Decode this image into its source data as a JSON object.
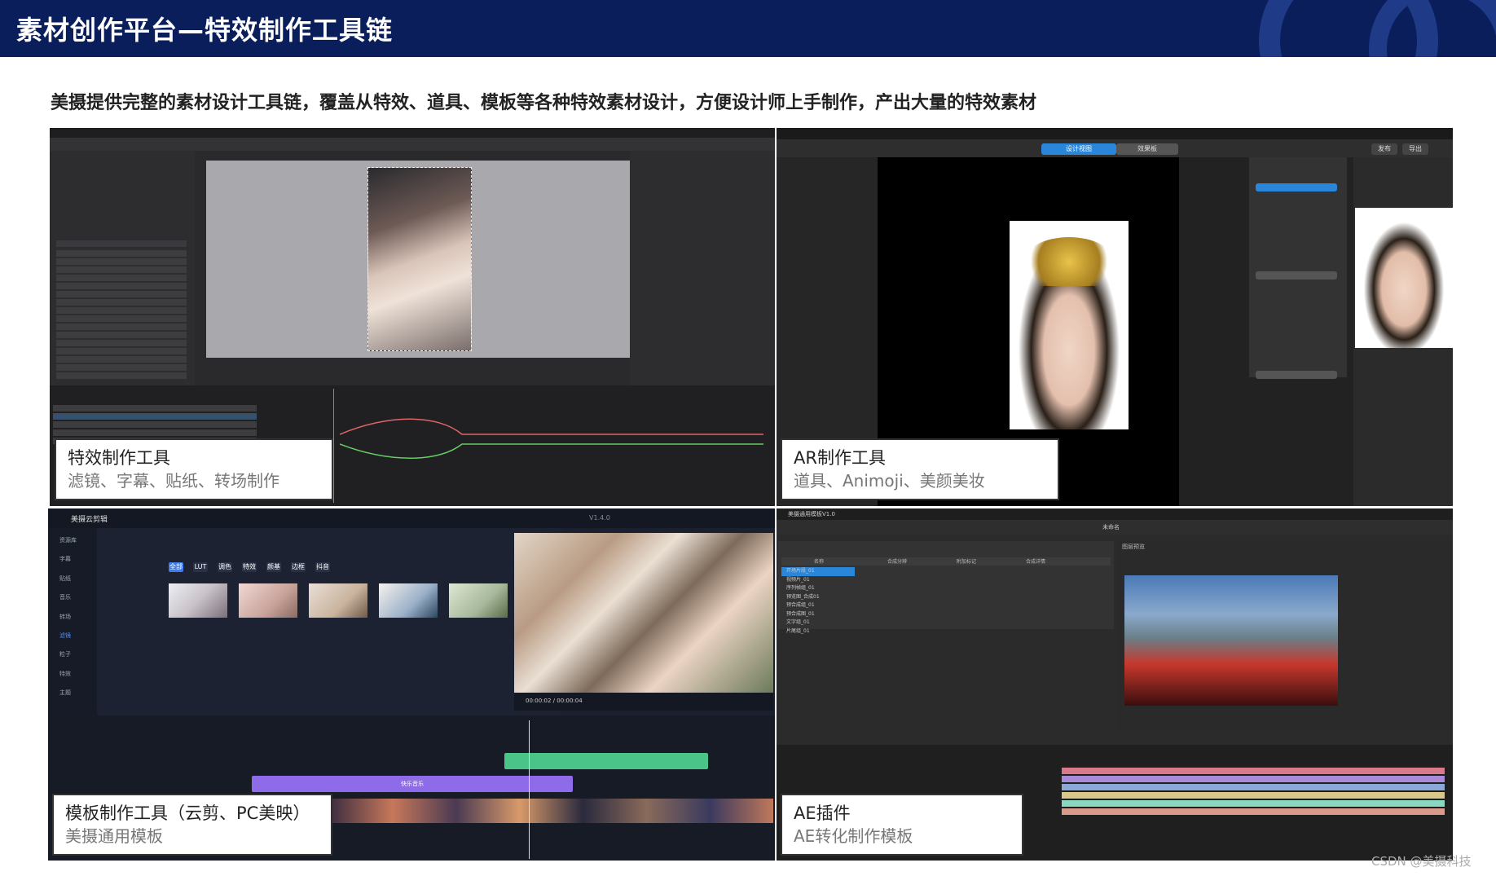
{
  "header": {
    "title": "素材创作平台—特效制作工具链"
  },
  "subtitle": "美摄提供完整的素材设计工具链，覆盖从特效、道具、模板等各种特效素材设计，方便设计师上手制作，产出大量的特效素材",
  "panels": [
    {
      "caption_title": "特效制作工具",
      "caption_sub": "滤镜、字幕、贴纸、转场制作"
    },
    {
      "caption_title": "AR制作工具",
      "caption_sub": "道具、Animoji、美颜美妆",
      "tabs": [
        "设计视图",
        "效果板"
      ],
      "actions": [
        "发布",
        "导出"
      ]
    },
    {
      "caption_title": "模板制作工具（云剪、PC美映）",
      "caption_sub": "美摄通用模板",
      "app_name": "美摄云剪辑",
      "version": "V1.4.0",
      "time": "00:00:02 / 00:00:04",
      "filters": [
        "全部",
        "LUT",
        "调色",
        "特效",
        "颜基",
        "边框",
        "抖音"
      ],
      "sidebar": [
        "资源库",
        "字幕",
        "贴纸",
        "音乐",
        "转场",
        "滤镜",
        "粒子",
        "特效",
        "主题"
      ],
      "clip_bar_label": "快乐音乐"
    },
    {
      "caption_title": "AE插件",
      "caption_sub": "AE转化制作模板",
      "app_name": "美摄通用模板V1.0",
      "doc_name": "未命名",
      "table_headers": [
        "名称",
        "合成分辨",
        "附加标记",
        "合成详情"
      ],
      "rows": [
        "开场片段_01",
        "视频片_01",
        "序列帧组_01",
        "预览图_合成01",
        "预合成组_01",
        "预合成图_01",
        "文字组_01",
        "片尾组_01"
      ],
      "preview_label": "图层预览"
    }
  ],
  "footer_credit": "CSDN @美摄科技"
}
